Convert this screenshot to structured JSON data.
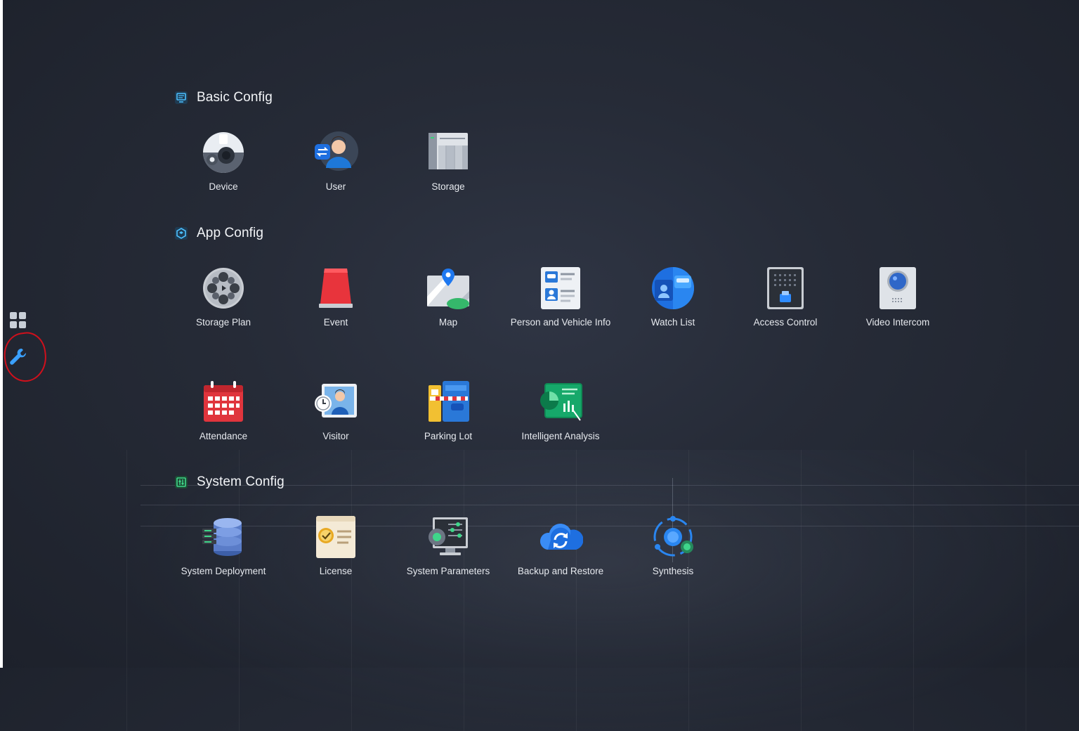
{
  "sidebar": {
    "apps_icon": "grid-apps-icon",
    "tools_icon": "wrench-icon"
  },
  "sections": {
    "basic": {
      "title": "Basic Config",
      "icon": "monitor-icon"
    },
    "app": {
      "title": "App Config",
      "icon": "hexagon-cube-icon"
    },
    "system": {
      "title": "System Config",
      "icon": "sliders-icon"
    }
  },
  "tiles": {
    "device": "Device",
    "user": "User",
    "storage": "Storage",
    "storage_plan": "Storage Plan",
    "event": "Event",
    "map": "Map",
    "person_vehicle": "Person and Vehicle Info",
    "watch_list": "Watch List",
    "access_control": "Access Control",
    "video_intercom": "Video Intercom",
    "attendance": "Attendance",
    "visitor": "Visitor",
    "parking_lot": "Parking Lot",
    "intelligent_analysis": "Intelligent Analysis",
    "system_deployment": "System Deployment",
    "license": "License",
    "system_parameters": "System Parameters",
    "backup_restore": "Backup and Restore",
    "synthesis": "Synthesis"
  },
  "colors": {
    "accent_blue": "#3aa0ff",
    "annotation_red": "#d0101c",
    "text": "#e6e9ee"
  }
}
